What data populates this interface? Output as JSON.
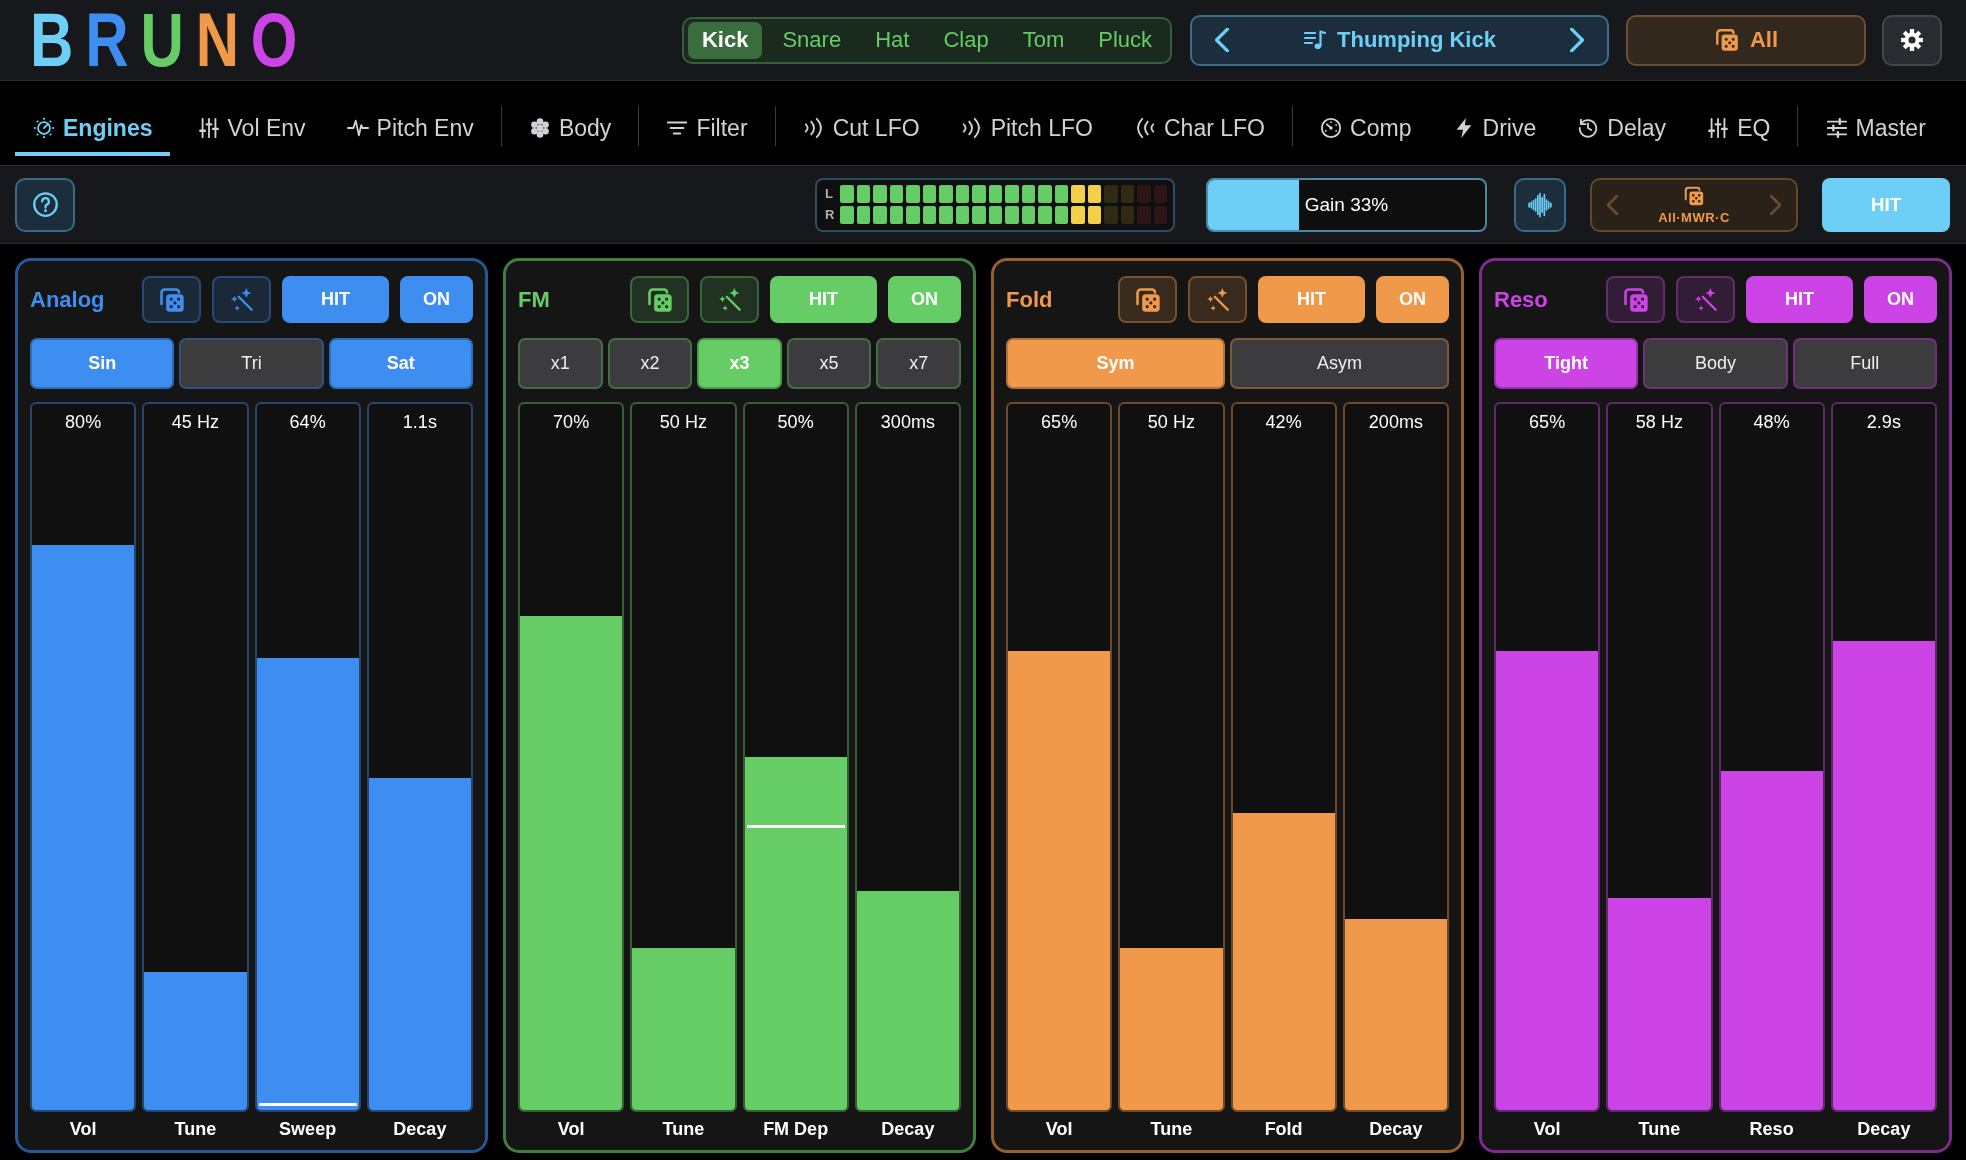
{
  "logo": {
    "letters": [
      {
        "text": "B",
        "color": "#6dcff6"
      },
      {
        "text": "R",
        "color": "#3d8ef0"
      },
      {
        "text": "U",
        "color": "#66cc66"
      },
      {
        "text": "N",
        "color": "#f0994a"
      },
      {
        "text": "O",
        "color": "#cc44e6"
      }
    ]
  },
  "categories": [
    {
      "label": "Kick",
      "selected": true
    },
    {
      "label": "Snare",
      "selected": false
    },
    {
      "label": "Hat",
      "selected": false
    },
    {
      "label": "Clap",
      "selected": false
    },
    {
      "label": "Tom",
      "selected": false
    },
    {
      "label": "Pluck",
      "selected": false
    }
  ],
  "preset": {
    "name": "Thumping Kick"
  },
  "kit_filter_button": {
    "label": "All"
  },
  "tab_groups": [
    {
      "tabs": [
        {
          "label": "Engines",
          "selected": true
        },
        {
          "label": "Vol Env",
          "selected": false
        },
        {
          "label": "Pitch Env",
          "selected": false
        }
      ]
    },
    {
      "tabs": [
        {
          "label": "Body",
          "selected": false
        }
      ]
    },
    {
      "tabs": [
        {
          "label": "Filter",
          "selected": false
        }
      ]
    },
    {
      "tabs": [
        {
          "label": "Cut LFO",
          "selected": false
        },
        {
          "label": "Pitch LFO",
          "selected": false
        },
        {
          "label": "Char LFO",
          "selected": false
        }
      ]
    },
    {
      "tabs": [
        {
          "label": "Comp",
          "selected": false
        },
        {
          "label": "Drive",
          "selected": false
        },
        {
          "label": "Delay",
          "selected": false
        },
        {
          "label": "EQ",
          "selected": false
        }
      ]
    },
    {
      "tabs": [
        {
          "label": "Master",
          "selected": false
        }
      ]
    }
  ],
  "toolbar": {
    "meter": {
      "channels": [
        {
          "label": "L",
          "level": 0.8
        },
        {
          "label": "R",
          "level": 0.8
        }
      ]
    },
    "gain": {
      "label": "Gain 33%",
      "level": 0.33
    },
    "kit": {
      "label": "All·MWR·C"
    },
    "hit_button": {
      "label": "HIT"
    }
  },
  "engines": [
    {
      "title": "Analog",
      "color": "#3d8ef0",
      "hit_label": "HIT",
      "on_label": "ON",
      "on": true,
      "modes": [
        {
          "label": "Sin",
          "selected": true
        },
        {
          "label": "Tri",
          "selected": false
        },
        {
          "label": "Sat",
          "selected": true
        }
      ],
      "faders": [
        {
          "value": "80%",
          "label": "Vol",
          "level": 0.8
        },
        {
          "value": "45 Hz",
          "label": "Tune",
          "level": 0.195
        },
        {
          "value": "64%",
          "label": "Sweep",
          "level": 0.64,
          "marker": {
            "level": 0.005
          }
        },
        {
          "value": "1.1s",
          "label": "Decay",
          "level": 0.47
        }
      ]
    },
    {
      "title": "FM",
      "color": "#66cc66",
      "hit_label": "HIT",
      "on_label": "ON",
      "on": true,
      "modes": [
        {
          "label": "x1",
          "selected": false
        },
        {
          "label": "x2",
          "selected": false
        },
        {
          "label": "x3",
          "selected": true
        },
        {
          "label": "x5",
          "selected": false
        },
        {
          "label": "x7",
          "selected": false
        }
      ],
      "faders": [
        {
          "value": "70%",
          "label": "Vol",
          "level": 0.7
        },
        {
          "value": "50 Hz",
          "label": "Tune",
          "level": 0.23
        },
        {
          "value": "50%",
          "label": "FM Dep",
          "level": 0.5,
          "marker": {
            "level": 0.4
          }
        },
        {
          "value": "300ms",
          "label": "Decay",
          "level": 0.31
        }
      ]
    },
    {
      "title": "Fold",
      "color": "#f0994a",
      "hit_label": "HIT",
      "on_label": "ON",
      "on": true,
      "modes": [
        {
          "label": "Sym",
          "selected": true
        },
        {
          "label": "Asym",
          "selected": false
        }
      ],
      "faders": [
        {
          "value": "65%",
          "label": "Vol",
          "level": 0.65
        },
        {
          "value": "50 Hz",
          "label": "Tune",
          "level": 0.23
        },
        {
          "value": "42%",
          "label": "Fold",
          "level": 0.42
        },
        {
          "value": "200ms",
          "label": "Decay",
          "level": 0.27
        }
      ]
    },
    {
      "title": "Reso",
      "color": "#cc44e6",
      "hit_label": "HIT",
      "on_label": "ON",
      "on": true,
      "modes": [
        {
          "label": "Tight",
          "selected": true
        },
        {
          "label": "Body",
          "selected": false
        },
        {
          "label": "Full",
          "selected": false
        }
      ],
      "faders": [
        {
          "value": "65%",
          "label": "Vol",
          "level": 0.65
        },
        {
          "value": "58 Hz",
          "label": "Tune",
          "level": 0.3
        },
        {
          "value": "48%",
          "label": "Reso",
          "level": 0.48
        },
        {
          "value": "2.9s",
          "label": "Decay",
          "level": 0.665
        }
      ]
    }
  ]
}
